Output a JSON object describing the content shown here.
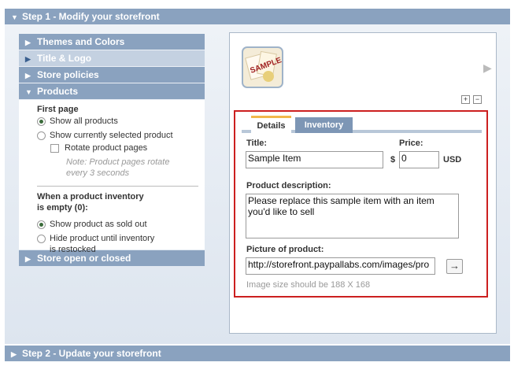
{
  "step1": {
    "label": "Step 1 - Modify your storefront"
  },
  "step2": {
    "label": "Step 2 - Update your storefront"
  },
  "sections": {
    "themes": "Themes and Colors",
    "title_logo": "Title & Logo",
    "policies": "Store policies",
    "products": "Products",
    "open_closed": "Store open or closed"
  },
  "products": {
    "first_page_label": "First page",
    "show_all": "Show all products",
    "show_selected": "Show currently selected product",
    "rotate": "Rotate product pages",
    "note_line1": "Note: Product pages rotate",
    "note_line2": "every 3 seconds",
    "empty_line1": "When a product inventory",
    "empty_line2": "is empty (0):",
    "sold_out": "Show product as sold out",
    "hide_line1": "Hide product until inventory",
    "hide_line2": "is restocked"
  },
  "thumb": {
    "text": "SAMPLE"
  },
  "buttons": {
    "plus": "+",
    "minus": "−",
    "go": "→"
  },
  "tabs": {
    "details": "Details",
    "inventory": "Inventory"
  },
  "form": {
    "title_label": "Title:",
    "title_value": "Sample Item",
    "price_label": "Price:",
    "currency_symbol": "$",
    "price_value": "0",
    "currency": "USD",
    "desc_label": "Product description:",
    "desc_line1": "Please replace this sample item with an item",
    "desc_line2": "you'd like to sell",
    "pic_label": "Picture of product:",
    "pic_value": "http://storefront.paypallabs.com/images/pro",
    "size_hint": "Image size should be 188 X 168"
  }
}
